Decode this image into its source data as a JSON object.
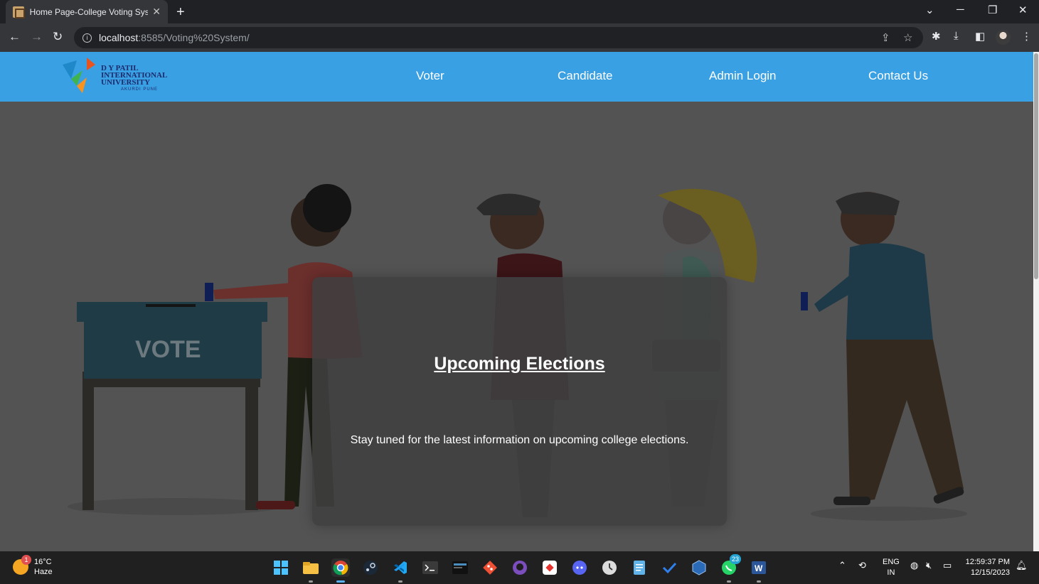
{
  "browser": {
    "tab_title": "Home Page-College Voting System",
    "url_host": "localhost",
    "url_rest": ":8585/Voting%20System/"
  },
  "site": {
    "logo": {
      "line1": "D Y PATIL",
      "line2": "INTERNATIONAL",
      "line3": "UNIVERSITY",
      "sub": "AKURDI PUNE"
    },
    "nav": [
      "Voter",
      "Candidate",
      "Admin Login",
      "Contact Us"
    ],
    "hero": {
      "ballot_box_label": "VOTE"
    },
    "card": {
      "title": "Upcoming Elections",
      "text": "Stay tuned for the latest information on upcoming college elections."
    }
  },
  "taskbar": {
    "weather": {
      "temp": "16°C",
      "condition": "Haze",
      "badge": "1"
    },
    "whatsapp_badge": "23",
    "language": {
      "line1": "ENG",
      "line2": "IN"
    },
    "clock": {
      "time": "12:59:37 PM",
      "date": "12/15/2023"
    }
  },
  "colors": {
    "navbar": "#3aa0e4",
    "overlay": "#535353",
    "card": "#404040"
  }
}
